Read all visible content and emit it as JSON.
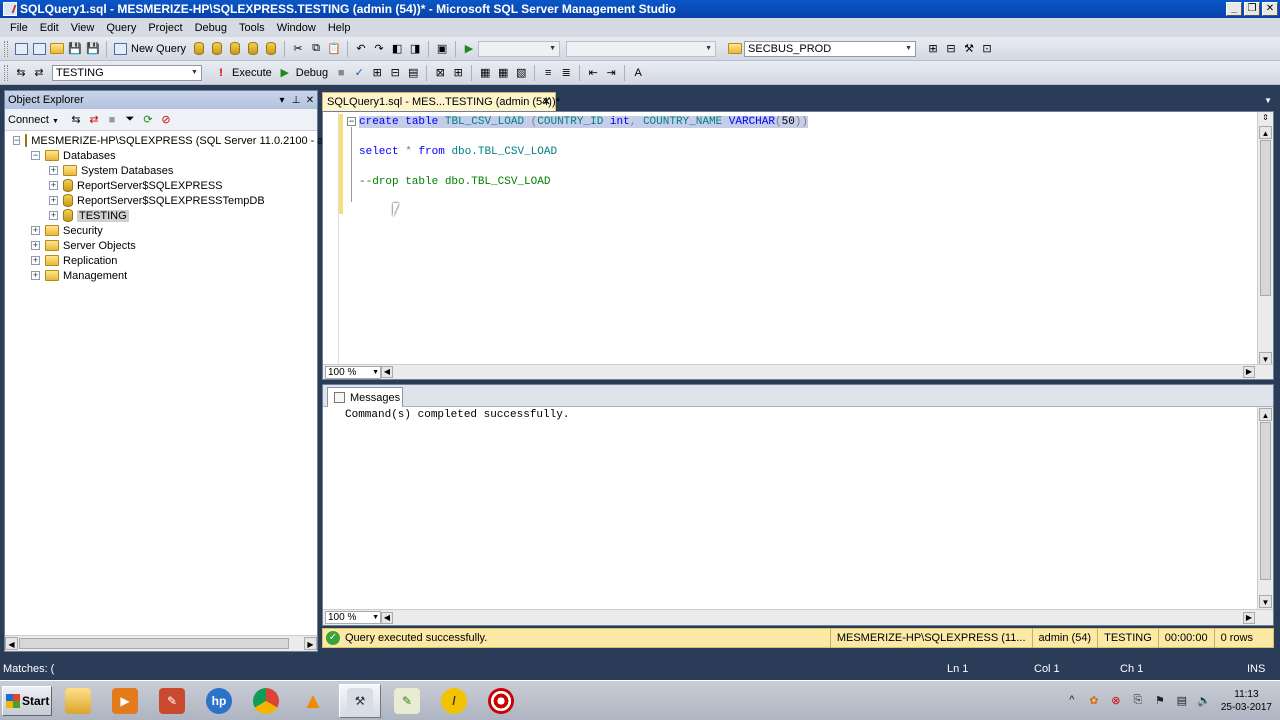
{
  "window": {
    "title": "SQLQuery1.sql - MESMERIZE-HP\\SQLEXPRESS.TESTING (admin (54))* - Microsoft SQL Server Management Studio",
    "minimize": "_",
    "restore": "❐",
    "close": "✕"
  },
  "menu": [
    "File",
    "Edit",
    "View",
    "Query",
    "Project",
    "Debug",
    "Tools",
    "Window",
    "Help"
  ],
  "toolbar1": {
    "new_query": "New Query",
    "solution_config": "",
    "platform": "",
    "server_combo": "SECBUS_PROD"
  },
  "toolbar2": {
    "database": "TESTING",
    "execute": "Execute",
    "debug": "Debug"
  },
  "object_explorer": {
    "title": "Object Explorer",
    "connect": "Connect",
    "server": "MESMERIZE-HP\\SQLEXPRESS (SQL Server 11.0.2100 - admi",
    "nodes": {
      "databases": "Databases",
      "system_databases": "System Databases",
      "report_server": "ReportServer$SQLEXPRESS",
      "report_server_temp": "ReportServer$SQLEXPRESSTempDB",
      "testing": "TESTING",
      "security": "Security",
      "server_objects": "Server Objects",
      "replication": "Replication",
      "management": "Management"
    }
  },
  "document_tab": {
    "label": "SQLQuery1.sql - MES...TESTING (admin (54))*",
    "close": "✕"
  },
  "editor": {
    "line1": {
      "kw1": "create",
      "kw2": "table",
      "tbl": "TBL_CSV_LOAD",
      "p1": "(",
      "col1": "COUNTRY_ID",
      "ty1": "int",
      "comma": ",",
      "col2": "COUNTRY_NAME",
      "ty2": "VARCHAR",
      "p2": "(",
      "num": "50",
      "p3": "))"
    },
    "line3": {
      "kw1": "select",
      "star": "*",
      "kw2": "from",
      "obj": "dbo.TBL_CSV_LOAD"
    },
    "line5": "--drop table dbo.TBL_CSV_LOAD",
    "zoom": "100 %"
  },
  "messages": {
    "tab": "Messages",
    "text": "Command(s) completed successfully.",
    "zoom": "100 %"
  },
  "query_status": {
    "message": "Query executed successfully.",
    "server": "MESMERIZE-HP\\SQLEXPRESS (11...",
    "user": "admin (54)",
    "database": "TESTING",
    "time": "00:00:00",
    "rows": "0 rows"
  },
  "app_status": {
    "left": "Matches: (",
    "ln": "Ln 1",
    "col": "Col 1",
    "ch": "Ch 1",
    "mode": "INS"
  },
  "taskbar": {
    "start": "Start",
    "clock_time": "11:13",
    "clock_date": "25-03-2017"
  },
  "colors": {
    "title_bar": "#0842a8",
    "status_yellow": "#fce9a6",
    "app_background": "#2b3c59",
    "keyword": "#0000ff",
    "identifier": "#008080",
    "comment": "#008000"
  }
}
